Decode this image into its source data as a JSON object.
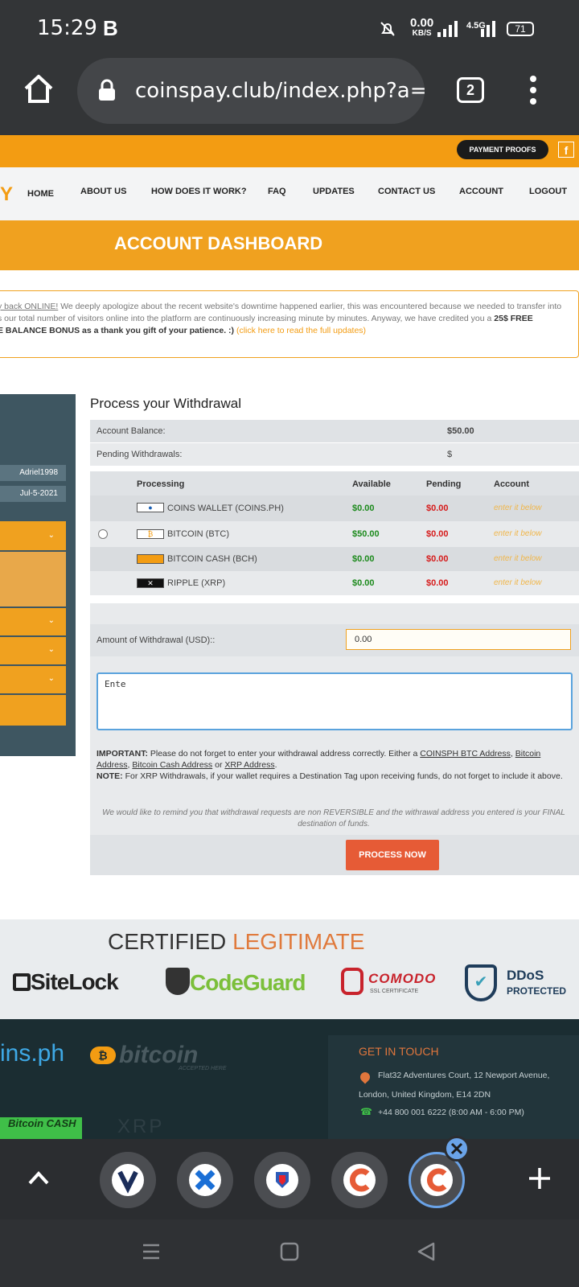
{
  "status_bar": {
    "time": "15:29",
    "carrier_icon": "B",
    "speed_value": "0.00",
    "speed_unit": "KB/S",
    "network_label": "4.5G",
    "battery": "71"
  },
  "browser": {
    "url": "coinspay.club/index.php?a=w",
    "tab_count": "2"
  },
  "site": {
    "payment_proofs": "PAYMENT PROOFS",
    "facebook": "f",
    "logo_fragment": "Y",
    "nav": [
      "HOME",
      "ABOUT US",
      "HOW DOES IT WORK?",
      "FAQ",
      "UPDATES",
      "CONTACT US",
      "ACCOUNT",
      "LOGOUT"
    ],
    "banner": "ACCOUNT DASHBOARD",
    "notice": {
      "lead": "y back ONLINE!",
      "line1": " We deeply apologize about the recent website's downtime happened earlier, this was encountered because we needed to transfer into",
      "line2a": "s our total number of visitors online into the platform are continuously increasing minute by minutes. Anyway, we have credited you a ",
      "bonus": "25$ FREE",
      "line3": "E BALANCE BONUS as a thank you gift of your patience. :)",
      "link": " (click here to read the full updates)"
    },
    "sidebar": {
      "username": "Adriel1998",
      "date": "Jul-5-2021"
    },
    "withdrawal": {
      "title": "Process your Withdrawal",
      "balance_label": "Account Balance:",
      "balance_value": "$50.00",
      "pending_label": "Pending Withdrawals:",
      "pending_value": "$",
      "headers": [
        "Processing",
        "Available",
        "Pending",
        "Account"
      ],
      "rows": [
        {
          "name": "COINS WALLET (COINS.PH)",
          "available": "$0.00",
          "pending": "$0.00",
          "account": "enter it below",
          "icon": "coins-ph-icon"
        },
        {
          "name": "BITCOIN (BTC)",
          "available": "$50.00",
          "pending": "$0.00",
          "account": "enter it below",
          "icon": "bitcoin-icon"
        },
        {
          "name": "BITCOIN CASH (BCH)",
          "available": "$0.00",
          "pending": "$0.00",
          "account": "enter it below",
          "icon": "bitcoin-cash-icon"
        },
        {
          "name": "RIPPLE (XRP)",
          "available": "$0.00",
          "pending": "$0.00",
          "account": "enter it below",
          "icon": "ripple-icon"
        }
      ],
      "amount_label": "Amount of Withdrawal (USD)::",
      "amount_value": "0.00",
      "address_value": "Ente",
      "important_label": "IMPORTANT:",
      "important_text": " Please do not forget to enter your withdrawal address correctly. Either a ",
      "addr_links": [
        "COINSPH BTC Address",
        "Bitcoin Address",
        "Bitcoin Cash Address",
        "XRP Address"
      ],
      "note_label": "NOTE:",
      "note_text": " For XRP Withdrawals, if your wallet requires a Destination Tag upon receiving funds, do not forget to include it above.",
      "reminder": "We would like to remind you that withdrawal requests are non REVERSIBLE and the withrawal address you entered is your FINAL destination of funds.",
      "button": "PROCESS NOW"
    },
    "certified": {
      "title_a": "CERTIFIED ",
      "title_b": "LEGITIMATE",
      "badges": [
        "SiteLock",
        "CodeGuard",
        "COMODO",
        "SSL CERTIFICATE",
        "DDoS",
        "PROTECTED"
      ]
    },
    "footer": {
      "coinsph": "ins.ph",
      "bitcoin": "bitcoin",
      "bitcoin_sub": "ACCEPTED HERE",
      "bitcoin_cash": "Bitcoin CASH",
      "xrp": "XRP",
      "get_in_touch": "GET IN TOUCH",
      "address1": "Flat32 Adventures Court, 12 Newport Avenue,",
      "address2": "London, United Kingdom, E14 2DN",
      "phone": "+44 800 001 6222 (8:00 AM - 6:00 PM)"
    }
  },
  "colors": {
    "accent": "#f0a11f",
    "dark": "#333537",
    "button": "#e65b36"
  }
}
